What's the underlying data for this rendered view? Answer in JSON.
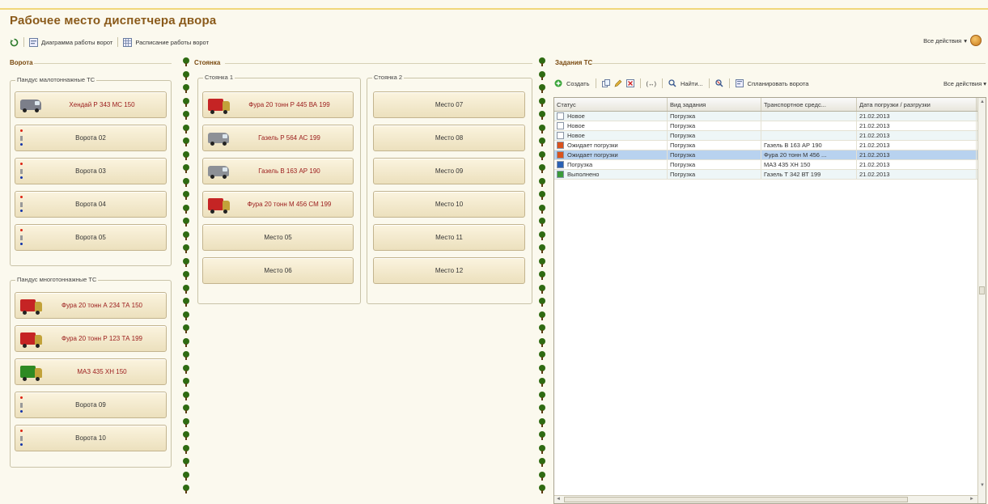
{
  "title": "Рабочее место диспетчера двора",
  "toolbar": {
    "diagram_label": "Диаграмма работы ворот",
    "schedule_label": "Расписание работы ворот"
  },
  "all_actions_label": "Все действия",
  "sections": {
    "gates": "Ворота",
    "parking": "Стоянка",
    "tasks": "Задания ТС"
  },
  "gates": {
    "light_group": "Пандус малотоннажные ТС",
    "heavy_group": "Пандус многотоннажные ТС",
    "light_slots": [
      {
        "label": "Хендай Р 343 МС 150",
        "vehicle": "van",
        "color": "#7c7f8a",
        "occupied": true
      },
      {
        "label": "Ворота 02",
        "vehicle": "gate",
        "occupied": false
      },
      {
        "label": "Ворота 03",
        "vehicle": "gate",
        "occupied": false
      },
      {
        "label": "Ворота 04",
        "vehicle": "gate",
        "occupied": false
      },
      {
        "label": "Ворота 05",
        "vehicle": "gate",
        "occupied": false
      }
    ],
    "heavy_slots": [
      {
        "label": "Фура 20 тонн А 234 ТА 150",
        "vehicle": "truck",
        "color": "#c52424",
        "occupied": true
      },
      {
        "label": "Фура 20 тонн  Р 123 ТА 199",
        "vehicle": "truck",
        "color": "#c52424",
        "occupied": true
      },
      {
        "label": "МАЗ 435 ХН 150",
        "vehicle": "truck",
        "color": "#2e8a23",
        "occupied": true
      },
      {
        "label": "Ворота 09",
        "vehicle": "gate",
        "occupied": false
      },
      {
        "label": "Ворота 10",
        "vehicle": "gate",
        "occupied": false
      }
    ]
  },
  "parking": {
    "group1": "Стоянка 1",
    "group2": "Стоянка 2",
    "col1": [
      {
        "label": "Фура 20 тонн Р 445 ВА 199",
        "vehicle": "truck",
        "color": "#c52424",
        "occupied": true
      },
      {
        "label": "Газель Р 564 АС 199",
        "vehicle": "van",
        "color": "#8d9096",
        "occupied": true
      },
      {
        "label": "Газель В 163 АР 190",
        "vehicle": "van",
        "color": "#8d9096",
        "occupied": true
      },
      {
        "label": "Фура 20 тонн М 456 СМ 199",
        "vehicle": "truck",
        "color": "#c52424",
        "occupied": true
      },
      {
        "label": "Место 05",
        "vehicle": "none",
        "occupied": false
      },
      {
        "label": "Место 06",
        "vehicle": "none",
        "occupied": false
      }
    ],
    "col2": [
      {
        "label": "Место 07"
      },
      {
        "label": "Место 08"
      },
      {
        "label": "Место 09"
      },
      {
        "label": "Место 10"
      },
      {
        "label": "Место 11"
      },
      {
        "label": "Место 12"
      }
    ]
  },
  "tasks": {
    "toolbar": {
      "create_label": "Создать",
      "find_label": "Найти...",
      "plan_gates_label": "Спланировать ворота",
      "all_actions_label": "Все действия"
    },
    "columns": [
      "Статус",
      "Вид задания",
      "Транспортное средс...",
      "Дата погрузки / разгрузки"
    ],
    "rows": [
      {
        "status": "Новое",
        "kind": "Погрузка",
        "vehicle": "",
        "date": "21.02.2013",
        "icon": "new-doc-icon",
        "selected": false
      },
      {
        "status": "Новое",
        "kind": "Погрузка",
        "vehicle": "",
        "date": "21.02.2013",
        "icon": "new-doc-icon",
        "selected": false
      },
      {
        "status": "Новое",
        "kind": "Погрузка",
        "vehicle": "",
        "date": "21.02.2013",
        "icon": "new-doc-icon",
        "selected": false
      },
      {
        "status": "Ожидает погрузки",
        "kind": "Погрузка",
        "vehicle": "Газель В 163 АР 190",
        "date": "21.02.2013",
        "icon": "waiting-icon",
        "selected": false
      },
      {
        "status": "Ожидает погрузки",
        "kind": "Погрузка",
        "vehicle": "Фура 20 тонн М 456 ...",
        "date": "21.02.2013",
        "icon": "waiting-icon",
        "selected": true
      },
      {
        "status": "Погрузка",
        "kind": "Погрузка",
        "vehicle": "МАЗ 435 ХН 150",
        "date": "21.02.2013",
        "icon": "loading-icon",
        "selected": false
      },
      {
        "status": "Выполнено",
        "kind": "Погрузка",
        "vehicle": "Газель Т 342 ВТ 199",
        "date": "21.02.2013",
        "icon": "done-icon",
        "selected": false
      }
    ]
  },
  "colors": {
    "title": "#8a5a1a",
    "section": "#7a4a10",
    "tree": "#2f6b12",
    "selected_row": "#b8d2ef"
  }
}
